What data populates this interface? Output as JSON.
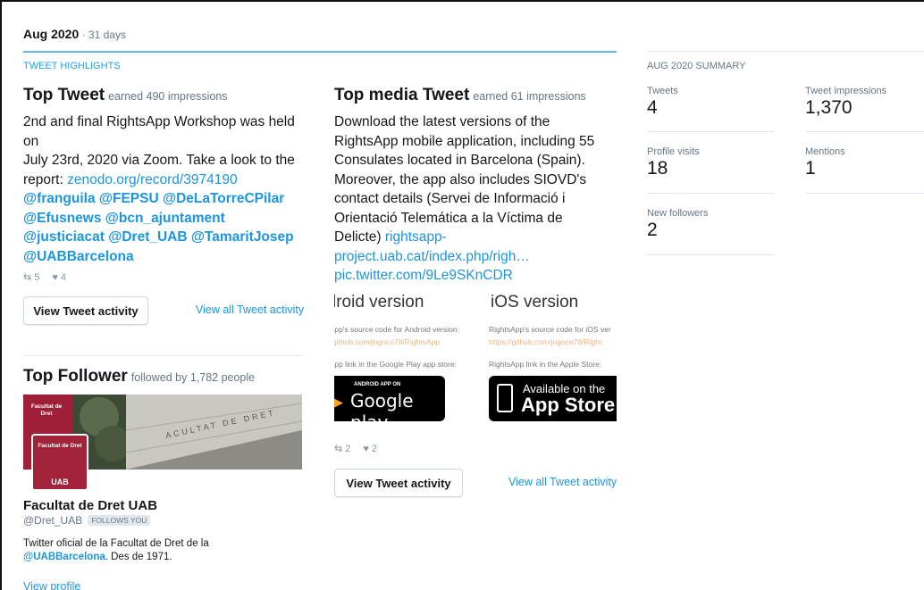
{
  "header": {
    "month": "Aug 2020",
    "sep": " · ",
    "days": "31 days",
    "highlights_label": "TWEET HIGHLIGHTS"
  },
  "top_tweet": {
    "title": "Top Tweet",
    "earned": "earned 490 impressions",
    "lines": [
      "2nd and final RightsApp Workshop was held",
      "on",
      "July 23rd, 2020 via Zoom. Take a look to the",
      "report: "
    ],
    "link_url": "zenodo.org/record/3974190",
    "mentions_1": "@franguila @FEPSU @DeLaTorreCPilar",
    "mentions_2": "@Efusnews @bcn_ajuntament",
    "mentions_3": "@justiciacat @Dret_UAB @TamaritJosep",
    "mentions_4": "@UABBarcelona",
    "retweets": "5",
    "likes": "4",
    "view_button": "View Tweet activity",
    "view_all": "View all Tweet activity"
  },
  "top_media": {
    "title": "Top media Tweet",
    "earned": "earned 61 impressions",
    "lines": [
      "Download the latest versions of the",
      "RightsApp mobile application, including 55",
      "Consulates located in Barcelona (Spain).",
      "Moreover, the app also includes SIOVD's",
      "contact details (Servei de Informació i",
      "Orientació Telemática a la Víctima de",
      "Delicte) "
    ],
    "link_1": "rightsapp-",
    "link_2": "project.uab.cat/index.php/righ…",
    "link_3": "pic.twitter.com/9Le9SKnCDR",
    "image": {
      "android_title": "lroid version",
      "ios_title": "iOS version",
      "android_src": "\\pp's source code for Android version:",
      "android_link": "github.com/jogoco78/RightsApp",
      "ios_src": "RightsApp's source code for iOS ver",
      "ios_link": "https://github.com/jogoco78/Right:",
      "android_store": "\\pp link in the Google Play app store:",
      "ios_store": "RightsApp link in the Apple Store:",
      "gp_small": "ANDROID APP ON",
      "gp_big": "Google play",
      "as_small": "Available on the",
      "as_big": "App Store"
    },
    "retweets": "2",
    "likes": "2",
    "view_button": "View Tweet activity",
    "view_all": "View all Tweet activity"
  },
  "top_follower": {
    "title": "Top Follower",
    "followed": "followed by 1,782 people",
    "banner_text": "ACULTAT  DE  DRET",
    "banner_logo": "Facultat de Dret",
    "avatar_text": "Facultat de Dret",
    "avatar_brand": "UAB",
    "name": "Facultat de Dret UAB",
    "handle": "@Dret_UAB",
    "follows_you": "FOLLOWS YOU",
    "bio_1": "Twitter oficial de la Facultat de Dret de la",
    "bio_mention": "@UABBarcelona",
    "bio_2": ". Des de 1971.",
    "view_profile": "View profile"
  },
  "summary": {
    "label": "AUG 2020 SUMMARY",
    "tweets_label": "Tweets",
    "tweets_value": "4",
    "impressions_label": "Tweet impressions",
    "impressions_value": "1,370",
    "profile_visits_label": "Profile visits",
    "profile_visits_value": "18",
    "mentions_label": "Mentions",
    "mentions_value": "1",
    "new_followers_label": "New followers",
    "new_followers_value": "2"
  },
  "colors": {
    "link": "#1b95e0",
    "accent": "#1da1f2",
    "muted": "#657786",
    "avatar_red": "#a2223a"
  }
}
